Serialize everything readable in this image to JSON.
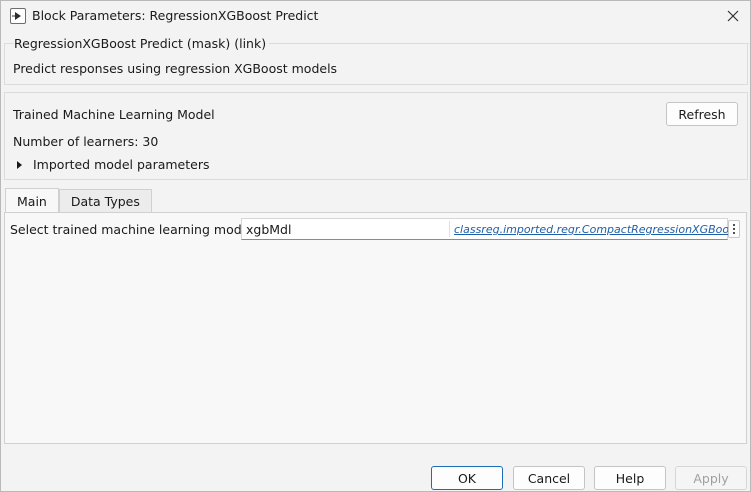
{
  "window": {
    "title": "Block Parameters: RegressionXGBoost Predict"
  },
  "mask": {
    "legend": "RegressionXGBoost Predict (mask) (link)",
    "description": "Predict responses using regression XGBoost models"
  },
  "model_section": {
    "title": "Trained Machine Learning Model",
    "refresh_label": "Refresh",
    "learners_text": "Number of learners: 30",
    "expander_label": "Imported model parameters"
  },
  "tabs": [
    {
      "label": "Main",
      "active": true
    },
    {
      "label": "Data Types",
      "active": false
    }
  ],
  "main_tab": {
    "param_label": "Select trained machine learning model",
    "param_value": "xgbMdl",
    "param_class_link": "classreg.imported.regr.CompactRegressionXGBoost"
  },
  "buttons": {
    "ok": "OK",
    "cancel": "Cancel",
    "help": "Help",
    "apply": "Apply"
  },
  "colors": {
    "link": "#1f5fa8",
    "primary_border": "#1c6cb8",
    "disabled_text": "#a0a0a0"
  }
}
